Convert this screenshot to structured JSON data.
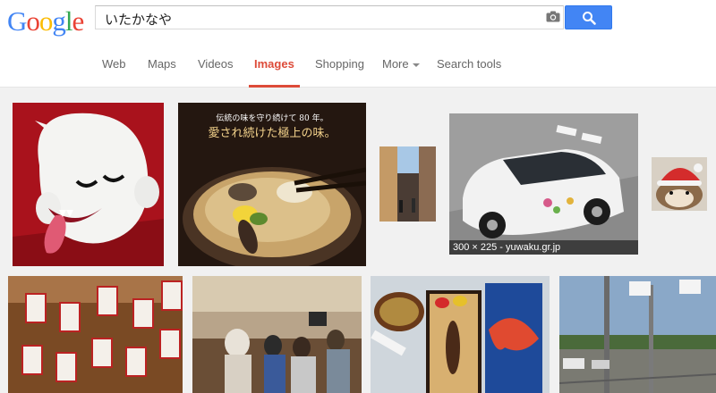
{
  "logo": {
    "letters": [
      "G",
      "o",
      "o",
      "g",
      "l",
      "e"
    ],
    "colors": [
      "#4285f4",
      "#ea4335",
      "#fbbc05",
      "#4285f4",
      "#34a853",
      "#ea4335"
    ]
  },
  "search": {
    "query": "いたかなや"
  },
  "icons": {
    "camera": "camera-icon",
    "search": "search-icon",
    "dropdown": "chevron-down-icon"
  },
  "tabs": [
    {
      "label": "Web"
    },
    {
      "label": "Maps"
    },
    {
      "label": "Videos"
    },
    {
      "label": "Images"
    },
    {
      "label": "Shopping"
    },
    {
      "label": "More"
    },
    {
      "label": "Search tools"
    }
  ],
  "results": {
    "img2_line1": "伝統の味を守り続けて 80 年。",
    "img2_line2": "愛され続けた極上の味。",
    "img5_caption": "300 × 225 - yuwaku.gr.jp"
  },
  "colors": {
    "accent": "#dd4b39",
    "button": "#4285f4"
  }
}
